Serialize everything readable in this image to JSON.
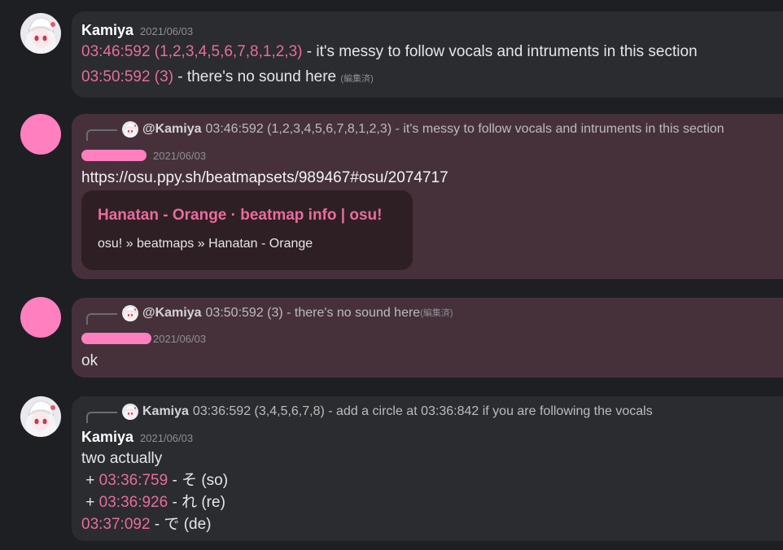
{
  "messages": [
    {
      "author": "Kamiya",
      "date": "2021/06/03",
      "lines": [
        {
          "ts": "03:46:592 (1,2,3,4,5,6,7,8,1,2,3)",
          "text": " - it's messy to follow vocals and intruments in this section"
        },
        {
          "ts": "03:50:592 (3)",
          "text": " - there's no sound here ",
          "edited": "(編集済)"
        }
      ]
    },
    {
      "reply": {
        "name": "@Kamiya",
        "text": "03:46:592 (1,2,3,4,5,6,7,8,1,2,3) - it's messy to follow vocals and intruments in this section"
      },
      "date": "2021/06/03",
      "link": "https://osu.ppy.sh/beatmapsets/989467#osu/2074717",
      "embed": {
        "title": "Hanatan - Orange · beatmap info | osu!",
        "desc": "osu! » beatmaps » Hanatan - Orange"
      }
    },
    {
      "reply": {
        "name": "@Kamiya",
        "text": "03:50:592 (3) - there's no sound here ",
        "edited": "(編集済)"
      },
      "date": "2021/06/03",
      "text": "ok"
    },
    {
      "reply": {
        "name": "Kamiya",
        "text": "03:36:592 (3,4,5,6,7,8) - add a circle at 03:36:842 if you are following the vocals"
      },
      "author": "Kamiya",
      "date": "2021/06/03",
      "text": "two actually",
      "items": [
        {
          "prefix": " + ",
          "ts": "03:36:759",
          "text": " - そ (so)"
        },
        {
          "prefix": " + ",
          "ts": "03:36:926",
          "text": " - れ (re)"
        },
        {
          "prefix": "",
          "ts": "03:37:092",
          "text": " - で (de)"
        }
      ]
    }
  ],
  "colors": {
    "timestamp": "#e86c9c",
    "background": "#1e1f22",
    "bubble_gray": "#2a2c30",
    "bubble_plum": "#46313a",
    "redaction": "#ff7fbf"
  }
}
